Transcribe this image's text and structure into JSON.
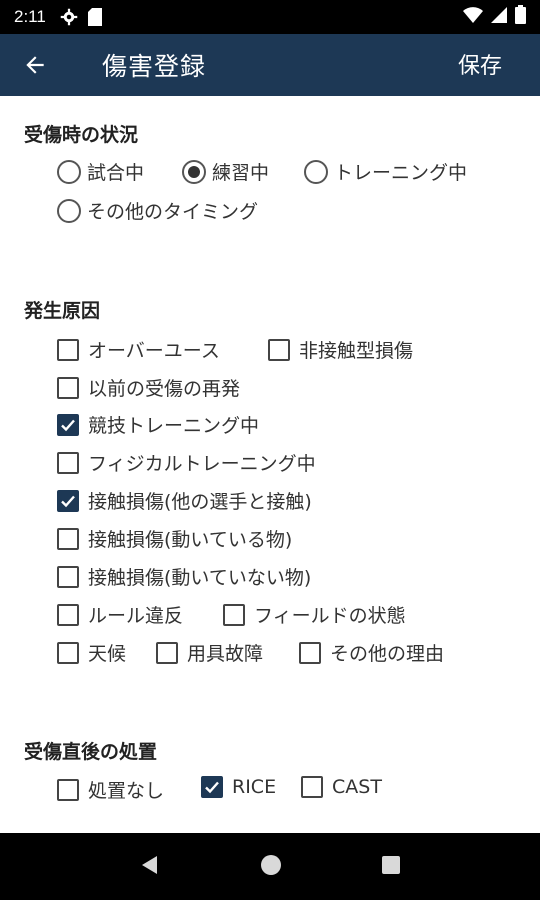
{
  "status_bar": {
    "time": "2:11",
    "icons": [
      "gear-icon",
      "sd-card-icon",
      "wifi-icon",
      "signal-icon",
      "battery-icon"
    ]
  },
  "app_bar": {
    "title": "傷害登録",
    "save_label": "保存",
    "back_icon": "arrow-left-icon"
  },
  "situation": {
    "title": "受傷時の状況",
    "options": [
      {
        "label": "試合中",
        "selected": false
      },
      {
        "label": "練習中",
        "selected": true
      },
      {
        "label": "トレーニング中",
        "selected": false
      },
      {
        "label": "その他のタイミング",
        "selected": false
      }
    ]
  },
  "cause": {
    "title": "発生原因",
    "options": [
      {
        "label": "オーバーユース",
        "checked": false
      },
      {
        "label": "非接触型損傷",
        "checked": false
      },
      {
        "label": "以前の受傷の再発",
        "checked": false
      },
      {
        "label": "競技トレーニング中",
        "checked": true
      },
      {
        "label": "フィジカルトレーニング中",
        "checked": false
      },
      {
        "label": "接触損傷(他の選手と接触)",
        "checked": true
      },
      {
        "label": "接触損傷(動いている物)",
        "checked": false
      },
      {
        "label": "接触損傷(動いていない物)",
        "checked": false
      },
      {
        "label": "ルール違反",
        "checked": false
      },
      {
        "label": "フィールドの状態",
        "checked": false
      },
      {
        "label": "天候",
        "checked": false
      },
      {
        "label": "用具故障",
        "checked": false
      },
      {
        "label": "その他の理由",
        "checked": false
      }
    ]
  },
  "treatment": {
    "title": "受傷直後の処置",
    "options": [
      {
        "label": "処置なし",
        "checked": false
      },
      {
        "label": "RICE",
        "checked": true
      },
      {
        "label": "CAST",
        "checked": false
      }
    ]
  },
  "nav_bar": {
    "icons": [
      "back-triangle-icon",
      "home-circle-icon",
      "recents-square-icon"
    ]
  },
  "colors": {
    "app_bar": "#1d3855",
    "accent": "#1d3855"
  }
}
